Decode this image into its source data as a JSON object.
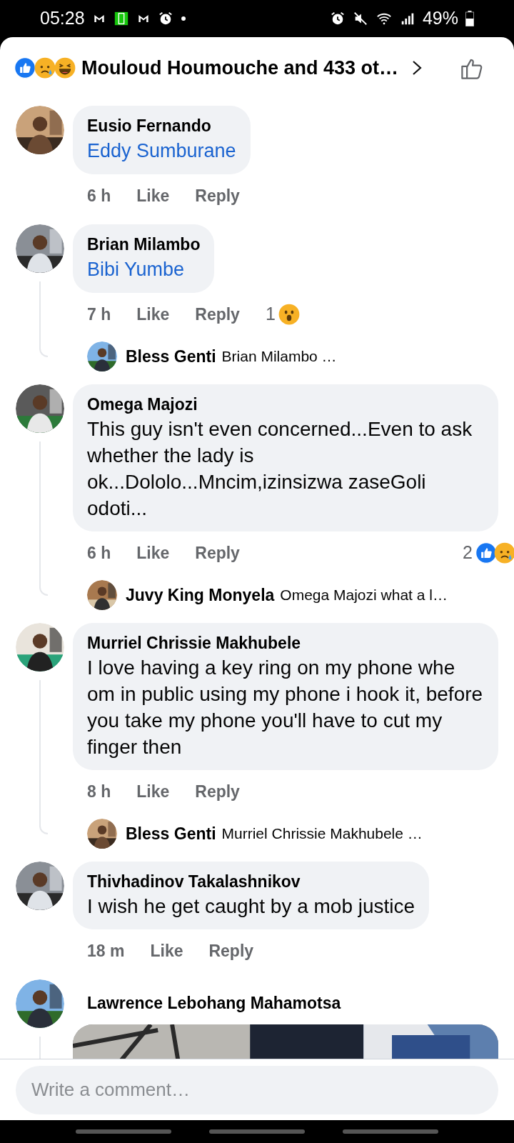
{
  "status_bar": {
    "time": "05:28",
    "battery": "49%"
  },
  "header": {
    "title": "Mouloud Houmouche and 433 ot…",
    "reactions": [
      {
        "kind": "like"
      },
      {
        "kind": "sad"
      },
      {
        "kind": "haha"
      }
    ]
  },
  "comments": [
    {
      "author": "Eusio Fernando",
      "text": "Eddy Sumburane",
      "kind": "mention",
      "time": "6 h",
      "like": "Like",
      "reply": "Reply"
    },
    {
      "author": "Brian Milambo",
      "text": "Bibi Yumbe",
      "kind": "mention",
      "time": "7 h",
      "like": "Like",
      "reply": "Reply",
      "reaction_count": "1",
      "reactions": [
        {
          "kind": "wow"
        }
      ],
      "reply_preview": {
        "author": "Bless Genti",
        "text": "Brian Milambo …"
      }
    },
    {
      "author": "Omega Majozi",
      "text": "This guy isn't even concerned...Even to ask whether the lady is ok...Dololo...Mncim,izinsizwa zaseGoli odoti...",
      "kind": "plain",
      "time": "6 h",
      "like": "Like",
      "reply": "Reply",
      "reaction_count": "2",
      "reactions": [
        {
          "kind": "like"
        },
        {
          "kind": "sad"
        }
      ],
      "reply_preview": {
        "author": "Juvy King Monyela",
        "text": "Omega Majozi what a l…"
      }
    },
    {
      "author": "Murriel Chrissie Makhubele",
      "text": "I love having a key ring on my phone whe om in public using my phone i hook it, before you take my phone you'll have to cut my finger then",
      "kind": "plain",
      "time": "8 h",
      "like": "Like",
      "reply": "Reply",
      "reply_preview": {
        "author": "Bless Genti",
        "text": "Murriel Chrissie Makhubele …"
      }
    },
    {
      "author": "Thivhadinov Takalashnikov",
      "text": "I wish he get caught by a mob justice",
      "kind": "plain",
      "time": "18 m",
      "like": "Like",
      "reply": "Reply"
    },
    {
      "author": "Lawrence Lebohang Mahamotsa",
      "kind": "picture"
    }
  ],
  "composer": {
    "placeholder": "Write a comment…"
  }
}
